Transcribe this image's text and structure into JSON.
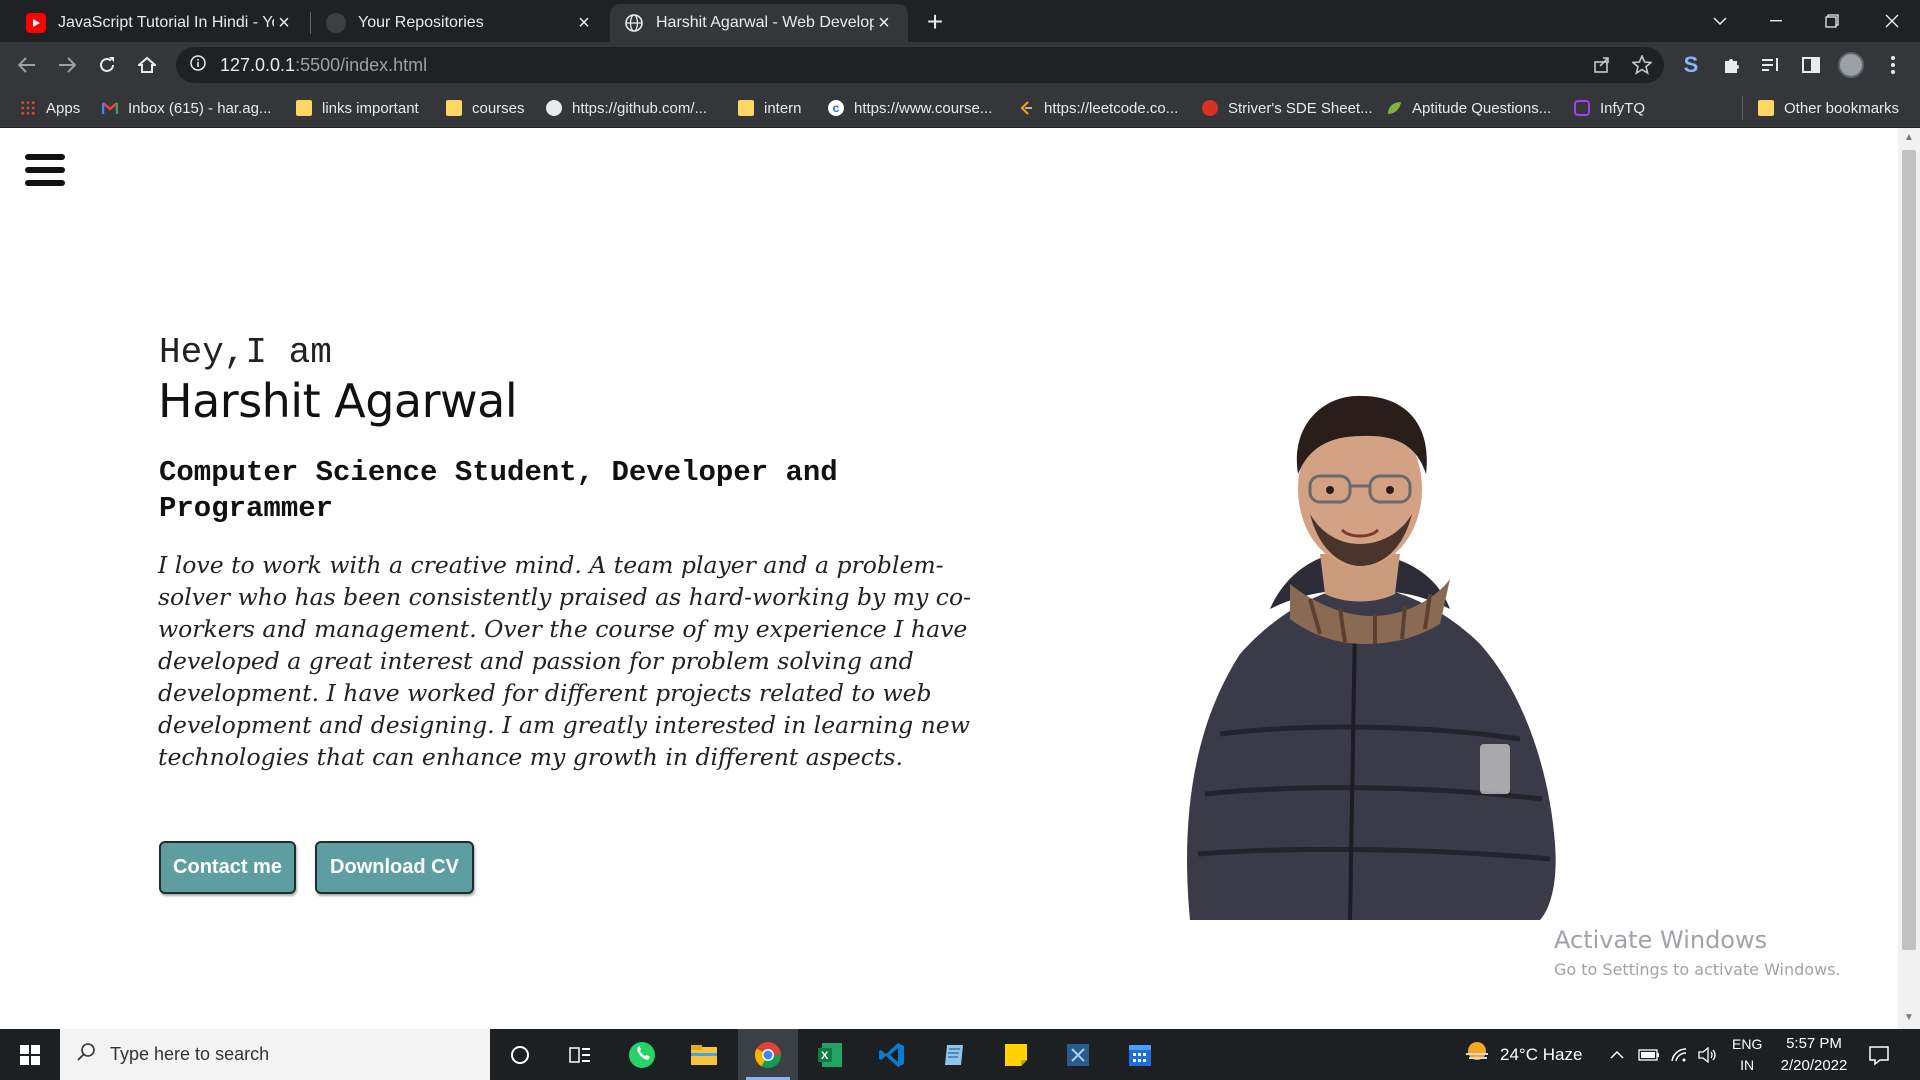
{
  "browser": {
    "tabs": [
      {
        "title": "JavaScript Tutorial In Hindi - YouTube",
        "icon": "youtube-icon",
        "active": false
      },
      {
        "title": "Your Repositories",
        "icon": "github-icon",
        "active": false
      },
      {
        "title": "Harshit Agarwal - Web Developer",
        "icon": "globe-icon",
        "active": true
      }
    ],
    "new_tab_label": "+",
    "address": {
      "host": "127.0.0.1",
      "rest": ":5500/index.html"
    },
    "bookmarks": [
      {
        "label": "Apps",
        "icon": "apps-grid-icon"
      },
      {
        "label": "Inbox (615) - har.ag...",
        "icon": "gmail-icon"
      },
      {
        "label": "links important",
        "icon": "folder-icon"
      },
      {
        "label": "courses",
        "icon": "folder-icon"
      },
      {
        "label": "https://github.com/...",
        "icon": "github-icon"
      },
      {
        "label": "intern",
        "icon": "folder-icon"
      },
      {
        "label": "https://www.course...",
        "icon": "coursera-icon"
      },
      {
        "label": "https://leetcode.co...",
        "icon": "leetcode-icon"
      },
      {
        "label": "Striver's SDE Sheet...",
        "icon": "tuf-icon"
      },
      {
        "label": "Aptitude Questions...",
        "icon": "leaf-icon"
      },
      {
        "label": "InfyTQ",
        "icon": "infytq-icon"
      },
      {
        "label": "Other bookmarks",
        "icon": "folder-icon"
      }
    ]
  },
  "hero": {
    "greeting": "Hey,I am",
    "name": "Harshit Agarwal",
    "role": "Computer Science Student, Developer and Programmer",
    "bio": "I love to work with a creative mind. A team player and a problem-solver who has been consistently praised as hard-working by my co-workers and management. Over the course of my experience I have developed a great interest and passion for problem solving and development. I have worked for different projects related to web development and designing. I am greatly interested in learning new technologies that can enhance my growth in different aspects.",
    "buttons": {
      "contact": "Contact me",
      "download": "Download CV"
    }
  },
  "watermark": {
    "title": "Activate Windows",
    "subtitle": "Go to Settings to activate Windows."
  },
  "taskbar": {
    "search_placeholder": "Type here to search",
    "weather": "24°C  Haze",
    "lang_top": "ENG",
    "lang_bottom": "IN",
    "time": "5:57 PM",
    "date": "2/20/2022"
  },
  "colors": {
    "button_bg": "#5f9ea0",
    "chrome_dark": "#202124",
    "chrome_toolbar": "#35363a"
  }
}
